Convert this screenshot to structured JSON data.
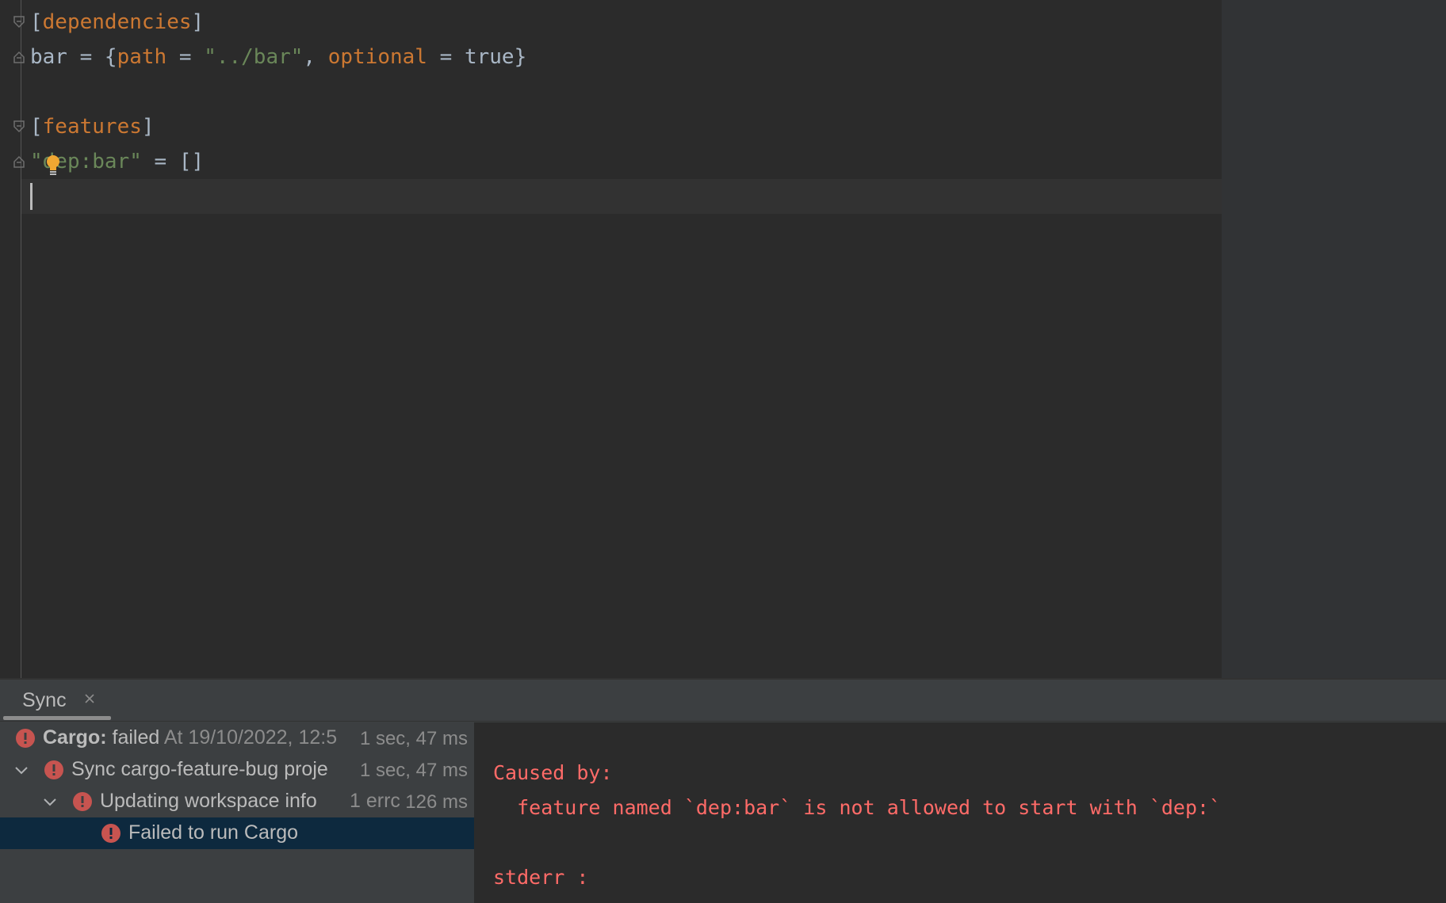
{
  "editor": {
    "lines": [
      {
        "open": "[",
        "key": "dependencies",
        "close": "]"
      },
      {
        "name": "bar",
        "eq": " = {",
        "k1": "path",
        "eq1": " = ",
        "v1": "\"../bar\"",
        "sep": ", ",
        "k2": "optional",
        "eq2": " = ",
        "v2": "true",
        "end": "}"
      },
      {
        "open": "[",
        "key": "features",
        "close": "]"
      },
      {
        "str": "\"dep:bar\"",
        "rest": " = []"
      }
    ]
  },
  "tool_window": {
    "tab_label": "Sync",
    "tree": [
      {
        "bold": "Cargo:",
        "label": " failed",
        "extra": "At 19/10/2022, 12:5",
        "time": "1 sec, 47 ms"
      },
      {
        "label": "Sync cargo-feature-bug proje",
        "time": "1 sec, 47 ms"
      },
      {
        "label": "Updating workspace info",
        "extra": "1 errc",
        "time": "126 ms"
      },
      {
        "label": "Failed to run Cargo"
      }
    ],
    "console": [
      "Caused by:",
      "  feature named `dep:bar` is not allowed to start with `dep:`",
      "stderr :"
    ]
  },
  "colors": {
    "editor_bg": "#2b2b2b",
    "keyword": "#cc7832",
    "string": "#6a8759",
    "error_text": "#ff6b68",
    "error_icon": "#c75450",
    "selection": "#0d293e"
  },
  "icons": [
    "fold-icon",
    "lightbulb-icon",
    "close-icon",
    "error-icon",
    "chevron-down-icon"
  ]
}
